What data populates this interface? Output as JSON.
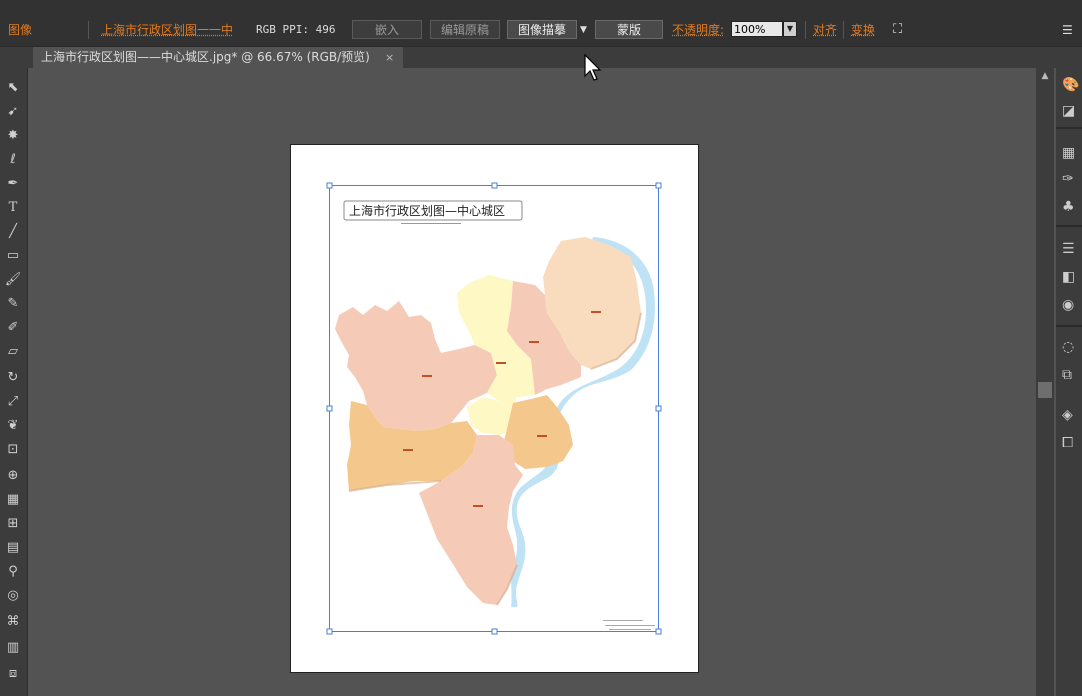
{
  "control_bar": {
    "image_label": "图像",
    "linked_file": "上海市行政区划图一一中",
    "color_info": "RGB  PPI: 496",
    "embed_button": "嵌入",
    "edit_original_button": "编辑原稿",
    "image_trace_button": "图像描摹",
    "mask_button": "蒙版",
    "opacity_label": "不透明度:",
    "opacity_value": "100%",
    "align_label": "对齐",
    "transform_label": "变换"
  },
  "document_tab": {
    "title": "上海市行政区划图——中心城区.jpg* @ 66.67% (RGB/预览)",
    "close": "×"
  },
  "map": {
    "title": "上海市行政区划图—中心城区"
  },
  "colors": {
    "accent": "#e07b24",
    "panel": "#323232",
    "canvas": "#535353",
    "selection": "#4a7fd6",
    "river": "#bfe2f5",
    "region_pink": "#f5cbb8",
    "region_yellow": "#fdf8c4",
    "region_peach": "#f9dcbd",
    "region_orange": "#f4c78c"
  },
  "tools": [
    "selection-tool",
    "direct-selection-tool",
    "magic-wand-tool",
    "lasso-tool",
    "pen-tool",
    "type-tool",
    "line-tool",
    "rectangle-tool",
    "paintbrush-tool",
    "pencil-tool",
    "blob-brush-tool",
    "eraser-tool",
    "rotate-tool",
    "scale-tool",
    "warp-tool",
    "free-transform-tool",
    "shape-builder-tool",
    "perspective-grid-tool",
    "mesh-tool",
    "gradient-tool",
    "eyedropper-tool",
    "blend-tool",
    "symbol-sprayer-tool",
    "column-graph-tool",
    "artboard-tool"
  ]
}
